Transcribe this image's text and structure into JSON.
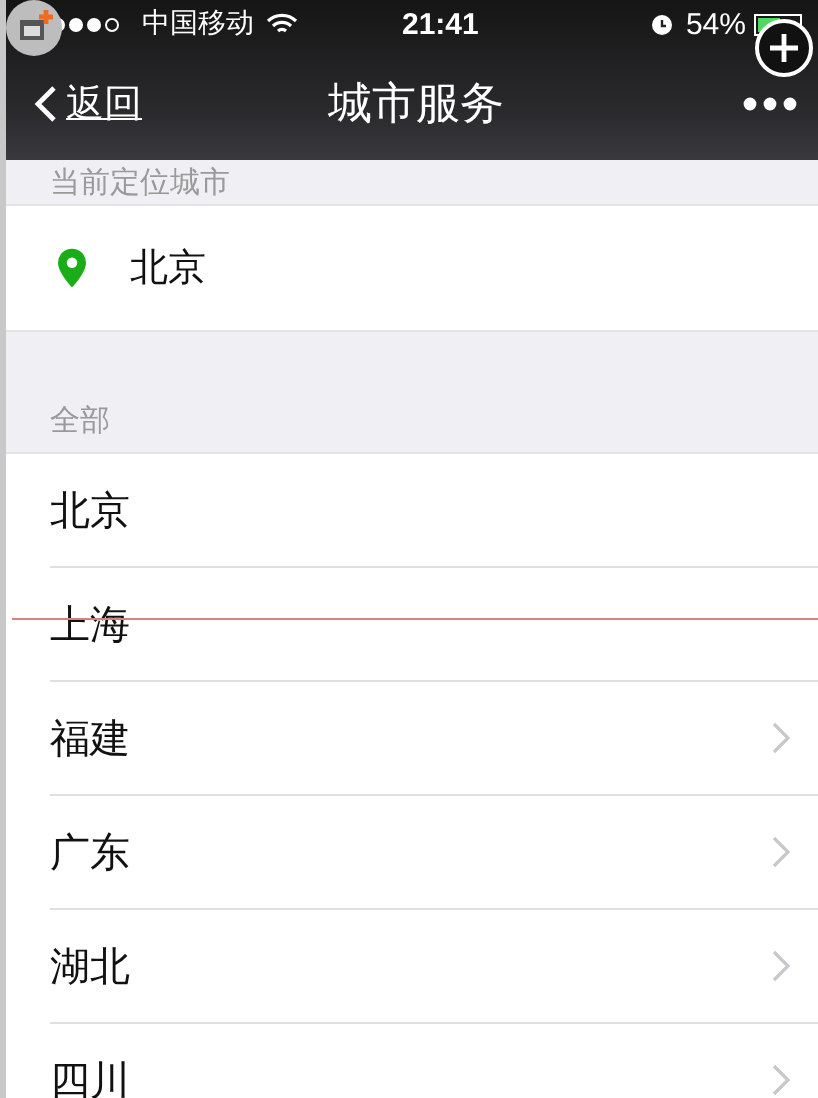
{
  "status_bar": {
    "carrier": "中国移动",
    "time": "21:41",
    "battery": "54%"
  },
  "nav_bar": {
    "back": "返回",
    "title": "城市服务"
  },
  "current_location": {
    "header": "当前定位城市",
    "city": "北京"
  },
  "all_cities": {
    "header": "全部",
    "items": [
      {
        "name": "北京",
        "expandable": false
      },
      {
        "name": "上海",
        "expandable": false
      },
      {
        "name": "福建",
        "expandable": true
      },
      {
        "name": "广东",
        "expandable": true
      },
      {
        "name": "湖北",
        "expandable": true
      },
      {
        "name": "四川",
        "expandable": true
      }
    ]
  }
}
